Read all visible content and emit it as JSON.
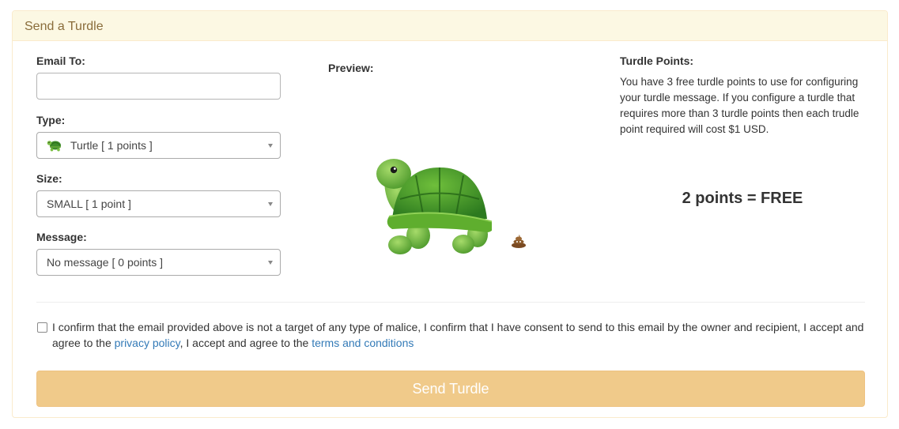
{
  "panel": {
    "title": "Send a Turdle"
  },
  "form": {
    "email_label": "Email To:",
    "email_value": "",
    "type_label": "Type:",
    "type_selected": "Turtle [ 1 points ]",
    "type_icon": "turtle-icon",
    "size_label": "Size:",
    "size_selected": "SMALL [ 1 point ]",
    "message_label": "Message:",
    "message_selected": "No message [ 0 points ]"
  },
  "preview": {
    "label": "Preview:",
    "image": "turtle-icon",
    "decoration": "poop-icon"
  },
  "turdle_points": {
    "title": "Turdle Points:",
    "description": "You have 3 free turdle points to use for configuring your turdle message. If you configure a turdle that requires more than 3 turdle points then each trudle point required will cost $1 USD.",
    "summary": "2 points = FREE"
  },
  "consent": {
    "text_1": "I confirm that the email provided above is not a target of any type of malice, I confirm that I have consent to send to this email by the owner and recipient, I accept and agree to the ",
    "privacy_link": "privacy policy",
    "text_2": ", I accept and agree to the ",
    "terms_link": "terms and conditions"
  },
  "submit": {
    "label": "Send Turdle"
  },
  "colors": {
    "heading_bg": "#fcf8e3",
    "heading_text": "#8a6d3b",
    "button_bg": "#f0ca8a",
    "link": "#337ab7"
  }
}
